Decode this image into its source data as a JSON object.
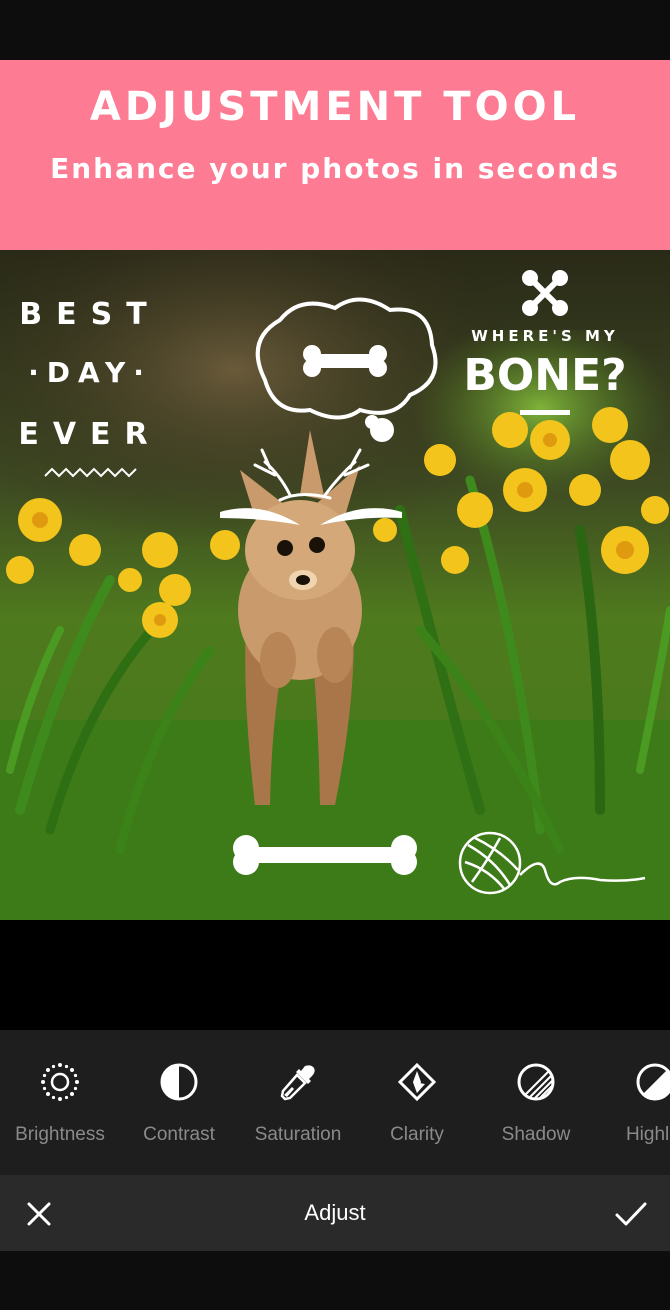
{
  "banner": {
    "title": "ADJUSTMENT TOOL",
    "subtitle": "Enhance your photos in seconds",
    "color": "#fd7b93"
  },
  "stickers": {
    "best_day_ever": [
      "BEST",
      "·DAY·",
      "EVER"
    ],
    "wheres_my": "WHERE'S MY",
    "bone_question": "BONE?"
  },
  "tools": [
    {
      "label": "Brightness",
      "icon": "brightness-icon"
    },
    {
      "label": "Contrast",
      "icon": "contrast-icon"
    },
    {
      "label": "Saturation",
      "icon": "saturation-icon"
    },
    {
      "label": "Clarity",
      "icon": "clarity-icon"
    },
    {
      "label": "Shadow",
      "icon": "shadow-icon"
    },
    {
      "label": "Highlig",
      "icon": "highlight-icon"
    }
  ],
  "action_bar": {
    "title": "Adjust",
    "close_icon": "close-icon",
    "confirm_icon": "checkmark-icon"
  }
}
